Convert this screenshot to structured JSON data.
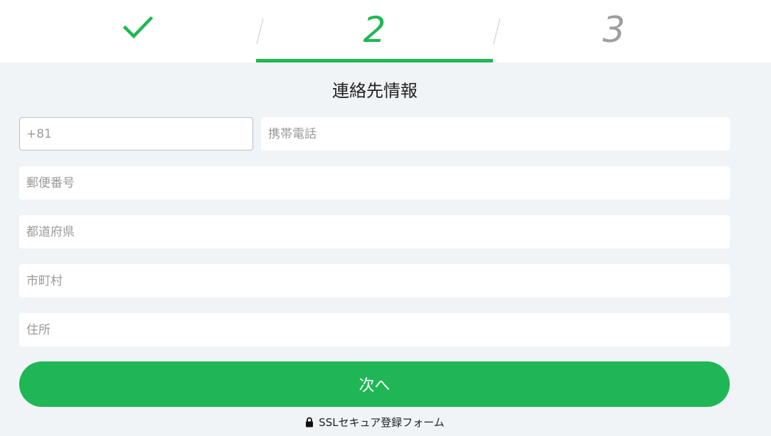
{
  "steps": [
    {
      "icon": "check-icon",
      "state": "done"
    },
    {
      "number": "2",
      "state": "active"
    },
    {
      "number": "3",
      "state": "upcoming"
    }
  ],
  "form": {
    "title": "連絡先情報",
    "fields": {
      "country_code": {
        "value": "",
        "placeholder": "+81"
      },
      "mobile_phone": {
        "value": "",
        "placeholder": "携帯電話"
      },
      "postal_code": {
        "value": "",
        "placeholder": "郵便番号"
      },
      "prefecture": {
        "value": "",
        "placeholder": "都道府県"
      },
      "city": {
        "value": "",
        "placeholder": "市町村"
      },
      "address": {
        "value": "",
        "placeholder": "住所"
      }
    },
    "next_label": "次へ",
    "ssl_note": "SSLセキュア登録フォーム",
    "ssl_icon": "lock-icon"
  },
  "colors": {
    "accent": "#1fb755",
    "background": "#f0f4f7",
    "inactive_step": "#9e9e9e"
  }
}
